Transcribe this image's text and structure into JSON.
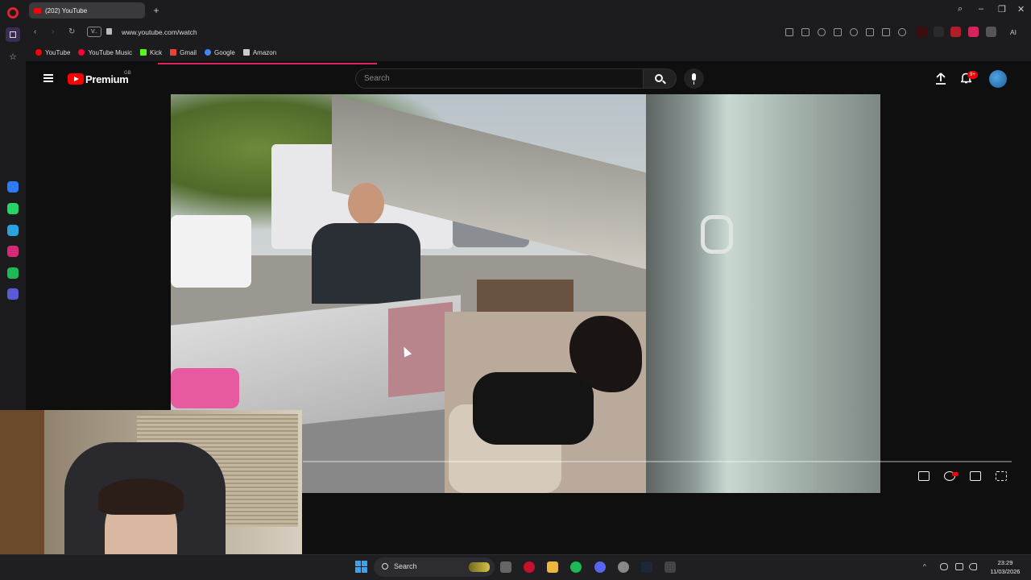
{
  "browser": {
    "tab_title": "(202) YouTube",
    "new_tab_icon": "plus-icon",
    "url": "www.youtube.com/watch",
    "site_badge": "V..",
    "ai_label": "AI"
  },
  "bookmarks": [
    {
      "label": "YouTube",
      "color": "#ff0000"
    },
    {
      "label": "YouTube Music",
      "color": "#ff0033"
    },
    {
      "label": "Kick",
      "color": "#53fc18"
    },
    {
      "label": "Gmail",
      "color": "#ea4335"
    },
    {
      "label": "Google",
      "color": "#4285f4"
    },
    {
      "label": "Amazon",
      "color": "#cccccc"
    }
  ],
  "youtube": {
    "brand": "Premium",
    "brand_superscript": "GB",
    "search_placeholder": "Search",
    "notification_count": "9+"
  },
  "taskbar": {
    "search_label": "Search",
    "time": "23:29",
    "date": "11/03/2026"
  },
  "colors": {
    "youtube_red": "#ff0000",
    "opera_red": "#e0242b",
    "page_bg": "#0f0f0f",
    "chrome_bg": "#1c1c1e",
    "progress_pink": "#e0245e"
  }
}
